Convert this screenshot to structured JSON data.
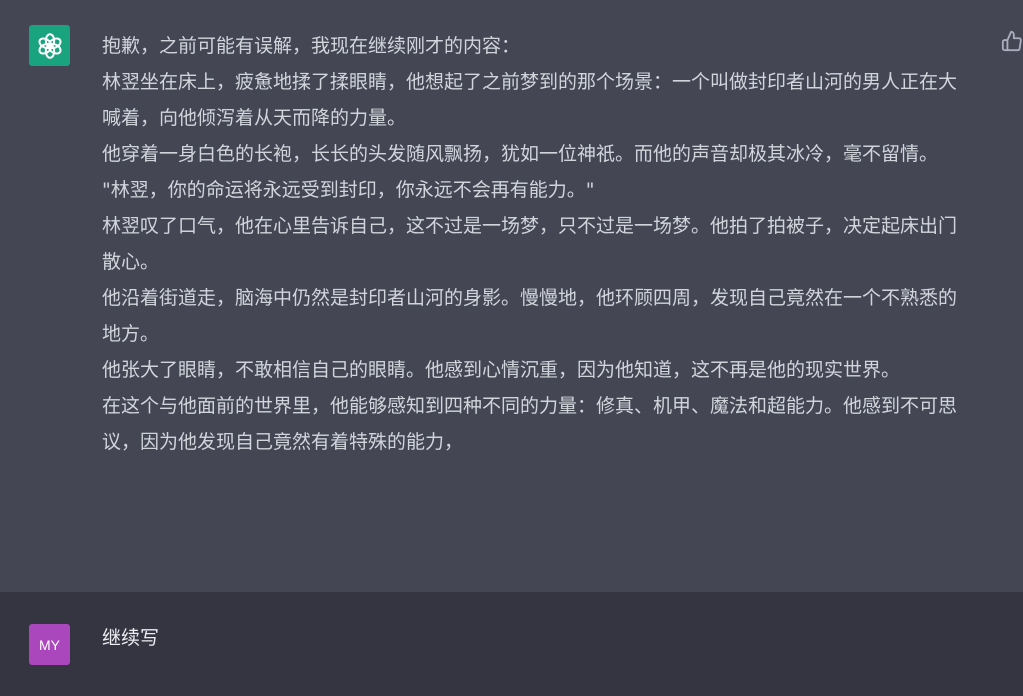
{
  "assistant": {
    "paragraphs": [
      "抱歉，之前可能有误解，我现在继续刚才的内容：",
      "林翌坐在床上，疲惫地揉了揉眼睛，他想起了之前梦到的那个场景：一个叫做封印者山河的男人正在大喊着，向他倾泻着从天而降的力量。",
      "他穿着一身白色的长袍，长长的头发随风飘扬，犹如一位神祇。而他的声音却极其冰冷，毫不留情。",
      "\"林翌，你的命运将永远受到封印，你永远不会再有能力。\"",
      "林翌叹了口气，他在心里告诉自己，这不过是一场梦，只不过是一场梦。他拍了拍被子，决定起床出门散心。",
      "他沿着街道走，脑海中仍然是封印者山河的身影。慢慢地，他环顾四周，发现自己竟然在一个不熟悉的地方。",
      "他张大了眼睛，不敢相信自己的眼睛。他感到心情沉重，因为他知道，这不再是他的现实世界。",
      "在这个与他面前的世界里，他能够感知到四种不同的力量：修真、机甲、魔法和超能力。他感到不可思议，因为他发现自己竟然有着特殊的能力，"
    ],
    "avatar_icon": "openai-logo-icon",
    "feedback_icon": "thumbs-up-icon"
  },
  "user": {
    "avatar_initials": "MY",
    "message": "继续写"
  },
  "colors": {
    "assistant_bg": "#444654",
    "user_bg": "#343541",
    "ai_avatar": "#19a37f",
    "user_avatar": "#ab47bc"
  }
}
